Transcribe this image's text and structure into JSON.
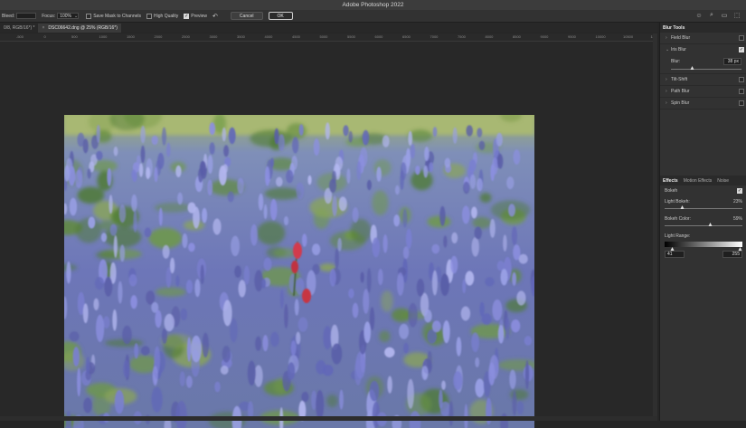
{
  "app": {
    "title": "Adobe Photoshop 2022"
  },
  "options": {
    "bleed_label": "Bleed:",
    "focus_label": "Focus:",
    "focus_value": "100%",
    "save_mask_label": "Save Mask to Channels",
    "high_quality_label": "High Quality",
    "preview_label": "Preview",
    "cancel_label": "Cancel",
    "ok_label": "OK"
  },
  "tabs": [
    {
      "label": "0/8, RGB/16*) *"
    },
    {
      "label": "DSC06642.dng @ 25% (RGB/16*)"
    }
  ],
  "ruler": {
    "ticks": [
      "-500",
      "0",
      "500",
      "1000",
      "1500",
      "2000",
      "2500",
      "3000",
      "3500",
      "4000",
      "4500",
      "5000",
      "5500",
      "6000",
      "6500",
      "7000",
      "7500",
      "8000",
      "8500",
      "9000",
      "9500",
      "10000",
      "10500",
      "11000"
    ]
  },
  "blur_tools": {
    "title": "Blur Tools",
    "items": [
      {
        "label": "Field Blur",
        "checked": false
      },
      {
        "label": "Iris Blur",
        "checked": true
      },
      {
        "label": "Tilt-Shift",
        "checked": false
      },
      {
        "label": "Path Blur",
        "checked": false
      },
      {
        "label": "Spin Blur",
        "checked": false
      }
    ],
    "blur_label": "Blur:",
    "blur_value": "38 px",
    "blur_level": 0.31
  },
  "effects": {
    "tabs": [
      "Effects",
      "Motion Effects",
      "Noise"
    ],
    "bokeh_label": "Bokeh",
    "light_bokeh_label": "Light Bokeh:",
    "light_bokeh_value": "23%",
    "light_bokeh_level": 0.23,
    "bokeh_color_label": "Bokeh Color:",
    "bokeh_color_value": "59%",
    "bokeh_color_level": 0.59,
    "light_range_label": "Light Range:",
    "light_range_low": "41",
    "light_range_high": "255"
  },
  "icons": {
    "check": "✓",
    "close": "×",
    "chevron_right": "›",
    "chevron_down": "⌄",
    "dropdown": "⌄",
    "user": "☺",
    "search": "⌕",
    "workspace": "▭",
    "share": "⬚",
    "reset": "↶"
  }
}
